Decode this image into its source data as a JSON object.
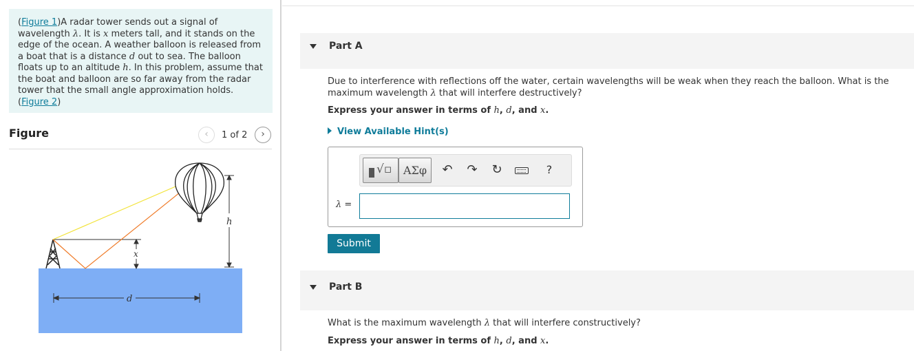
{
  "intro": {
    "figure1_link": "Figure 1",
    "text_a": "A radar tower sends out a signal of wavelength ",
    "lambda": "λ",
    "text_b": ". It is ",
    "x": "x",
    "text_c": " meters tall, and it stands on the edge of the ocean. A weather balloon is released from a boat that is a distance ",
    "d": "d",
    "text_d": " out to sea. The balloon floats up to an altitude ",
    "h": "h",
    "text_e": ". In this problem, assume that the boat and balloon are so far away from the radar tower that the small angle approximation holds.",
    "figure2_link": "Figure 2"
  },
  "figure": {
    "title": "Figure",
    "counter": "1 of 2",
    "labels": {
      "h": "h",
      "x": "x",
      "d": "d"
    },
    "colors": {
      "sea": "#7eaef5",
      "direct_ray": "#f2e33a",
      "reflected_ray": "#ef7a27"
    }
  },
  "partA": {
    "title": "Part A",
    "question_a": "Due to interference with reflections off the water, certain wavelengths will be weak when they reach the balloon. What is the maximum wavelength ",
    "question_lambda": "λ",
    "question_b": " that will interfere destructively?",
    "express_prefix": "Express your answer in terms of ",
    "var_h": "h",
    "sep1": ", ",
    "var_d": "d",
    "sep2": ", and ",
    "var_x": "x",
    "express_end": ".",
    "hints": "View Available Hint(s)",
    "answer_label": "λ =",
    "answer_value": "",
    "submit": "Submit"
  },
  "toolbar": {
    "templates_icon": "template-radical-icon",
    "greek": "ΑΣφ",
    "undo": "↶",
    "redo": "↷",
    "reset": "↻",
    "keyboard_icon": "keyboard-icon",
    "help": "?"
  },
  "partB": {
    "title": "Part B",
    "question_a": "What is the maximum wavelength ",
    "question_lambda": "λ",
    "question_b": " that will interfere constructively?",
    "express_prefix": "Express your answer in terms of ",
    "var_h": "h",
    "sep1": ", ",
    "var_d": "d",
    "sep2": ", and ",
    "var_x": "x",
    "express_end": "."
  }
}
